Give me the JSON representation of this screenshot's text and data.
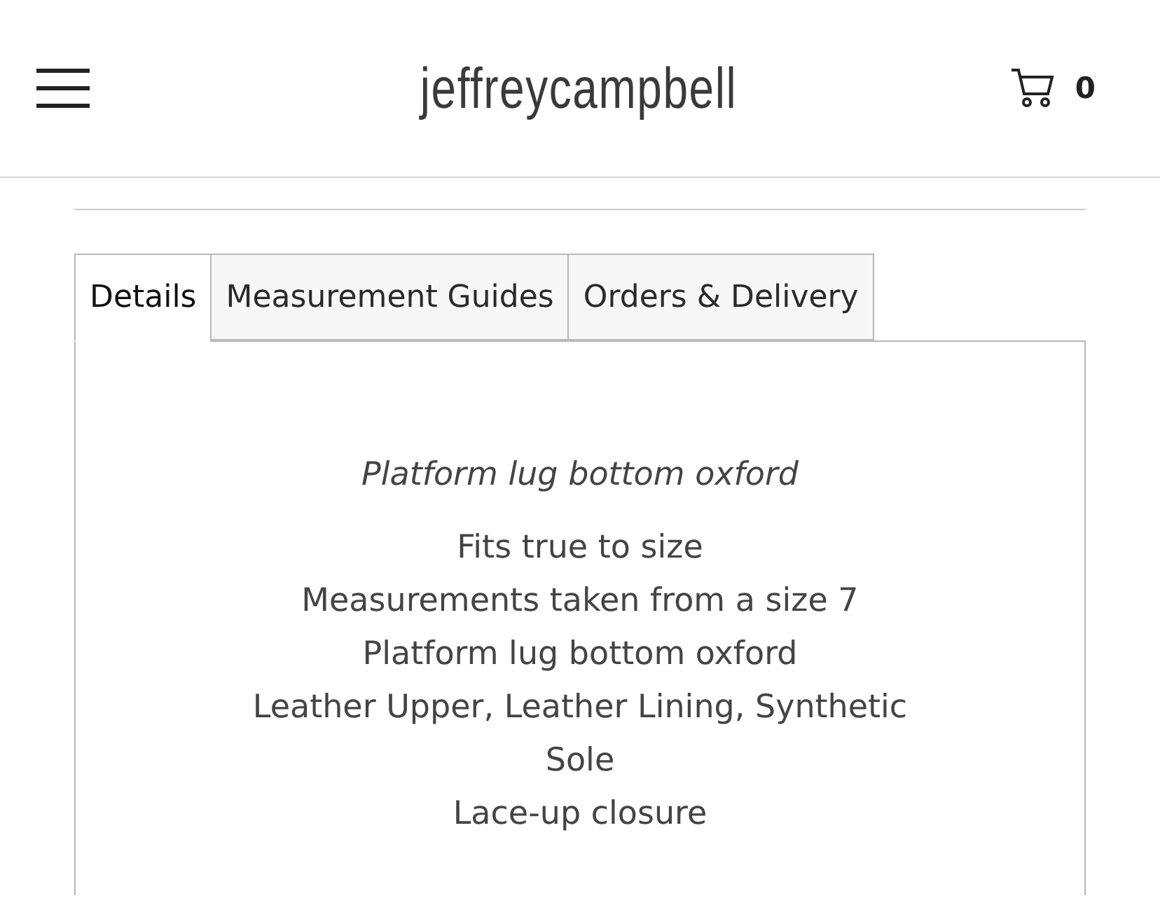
{
  "header": {
    "logo": "jeffreycampbell",
    "cart_count": "0"
  },
  "tabs": [
    {
      "label": "Details",
      "selected": true
    },
    {
      "label": "Measurement Guides",
      "selected": false
    },
    {
      "label": "Orders & Delivery",
      "selected": false
    }
  ],
  "details": {
    "subtitle": "Platform lug bottom oxford",
    "lines": [
      "Fits true to size",
      "Measurements taken from a size 7",
      "Platform lug bottom oxford",
      "Leather Upper, Leather Lining, Synthetic Sole",
      "Lace-up closure"
    ]
  }
}
